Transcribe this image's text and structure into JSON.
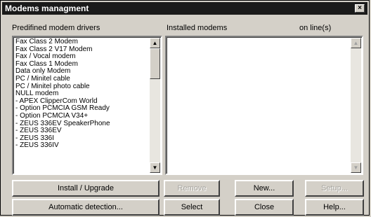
{
  "window": {
    "title": "Modems managment",
    "close_glyph": "×"
  },
  "left_panel": {
    "label": "Predifined modem drivers",
    "items": [
      "Fax Class 2 Modem",
      "Fax Class 2 V17 Modem",
      "Fax / Vocal modem",
      "Fax Class 1 Modem",
      "Data only Modem",
      "PC / Minitel cable",
      "PC / Minitel photo cable",
      "NULL modem",
      "- APEX ClipperCom World",
      "- Option PCMCIA GSM Ready",
      "- Option PCMCIA V34+",
      "- ZEUS 336EV SpeakerPhone",
      "- ZEUS 336EV",
      "- ZEUS 336I",
      "- ZEUS 336IV"
    ]
  },
  "right_panel": {
    "label": "Installed modems",
    "label_underline_char": "m",
    "status_header": "on line(s)"
  },
  "buttons": {
    "install_upgrade": "Install / Upgrade",
    "automatic_detection": "Automatic detection...",
    "remove": "Remove",
    "select": "Select",
    "new": "New...",
    "close": "Close",
    "setup": "Setup...",
    "help": "Help..."
  },
  "scroll_glyphs": {
    "up": "▲",
    "down": "▼"
  }
}
